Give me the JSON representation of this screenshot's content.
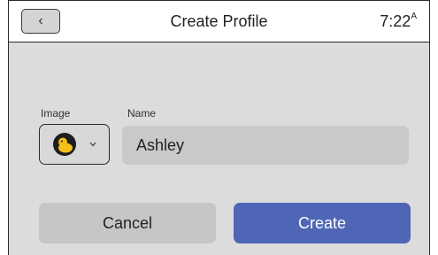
{
  "header": {
    "title": "Create Profile",
    "time": "7:22",
    "time_suffix": "A",
    "back_glyph": "‹"
  },
  "form": {
    "image_label": "Image",
    "image_icon": "duck-avatar-icon",
    "name_label": "Name",
    "name_value": "Ashley"
  },
  "actions": {
    "cancel_label": "Cancel",
    "create_label": "Create"
  },
  "colors": {
    "screen_bg": "#dcdcdc",
    "accent": "#4f66b6",
    "avatar_duck": "#f3c21a"
  }
}
